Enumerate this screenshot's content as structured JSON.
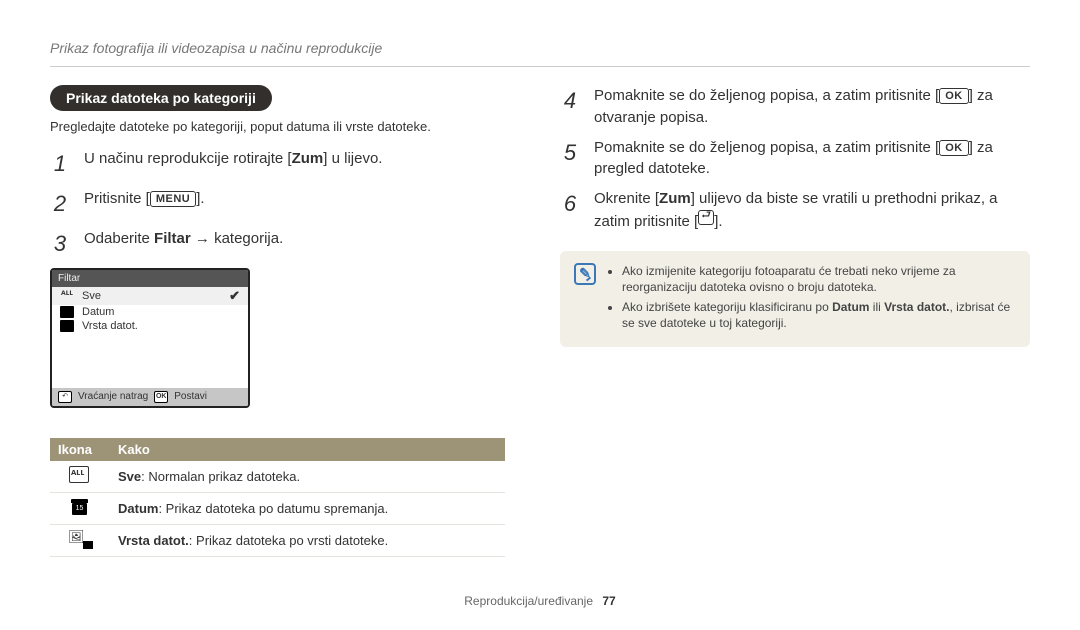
{
  "header": "Prikaz fotografija ili videozapisa u načinu reprodukcije",
  "section_title": "Prikaz datoteka po kategoriji",
  "intro": "Pregledajte datoteke po kategoriji, poput datuma ili vrste datoteke.",
  "left_steps": {
    "s1_a": "U načinu reprodukcije rotirajte [",
    "s1_b": "Zum",
    "s1_c": "] u lijevo.",
    "s2_a": "Pritisnite [",
    "s2_btn": "MENU",
    "s2_b": "].",
    "s3_a": "Odaberite ",
    "s3_b": "Filtar",
    "s3_c": " → kategorija."
  },
  "lcd": {
    "title": "Filtar",
    "items": [
      "Sve",
      "Datum",
      "Vrsta datot."
    ],
    "foot_back": "Vraćanje natrag",
    "foot_ok": "OK",
    "foot_set": "Postavi"
  },
  "table": {
    "h1": "Ikona",
    "h2": "Kako",
    "rows": [
      {
        "b": "Sve",
        "t": ": Normalan prikaz datoteka."
      },
      {
        "b": "Datum",
        "t": ": Prikaz datoteka po datumu spremanja."
      },
      {
        "b": "Vrsta datot.",
        "t": ": Prikaz datoteka po vrsti datoteke."
      }
    ]
  },
  "right_steps": {
    "s4_a": "Pomaknite se do željenog popisa, a zatim pritisnite [",
    "s4_btn": "OK",
    "s4_b": "] za otvaranje popisa.",
    "s5_a": "Pomaknite se do željenog popisa, a zatim pritisnite [",
    "s5_btn": "OK",
    "s5_b": "] za pregled datoteke.",
    "s6_a": "Okrenite [",
    "s6_b": "Zum",
    "s6_c": "] ulijevo da biste se vratili u prethodni prikaz, a zatim pritisnite [",
    "s6_d": "]."
  },
  "notes": [
    {
      "a": "Ako izmijenite kategoriju fotoaparatu će trebati neko vrijeme za reorganizaciju datoteka ovisno o broju datoteka."
    },
    {
      "a": "Ako izbrišete kategoriju klasificiranu po ",
      "b1": "Datum",
      "mid": " ili ",
      "b2": "Vrsta datot.",
      "c": ", izbrisat će se sve datoteke u toj kategoriji."
    }
  ],
  "footer": {
    "label": "Reprodukcija/uređivanje",
    "page": "77"
  }
}
